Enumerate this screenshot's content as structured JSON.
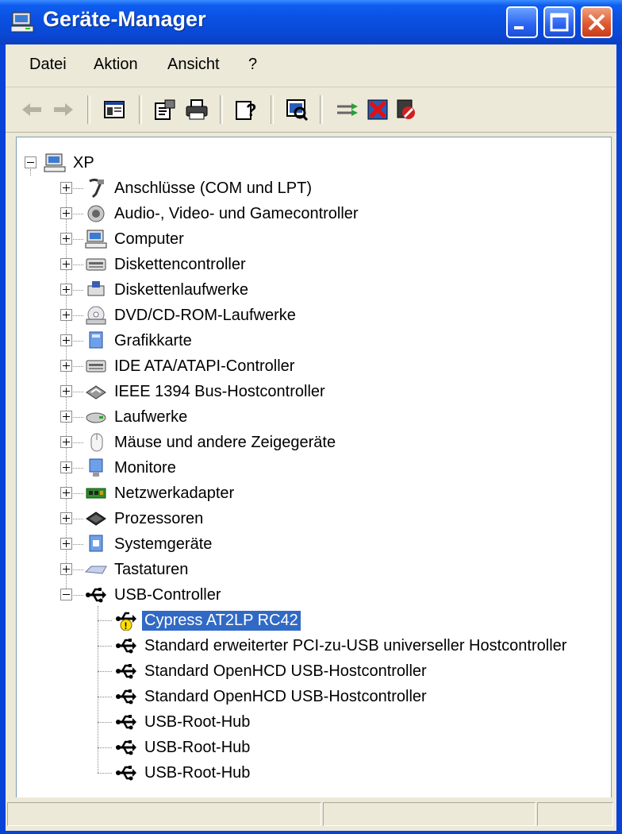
{
  "window": {
    "title": "Geräte-Manager"
  },
  "menu": [
    {
      "label": "Datei"
    },
    {
      "label": "Aktion"
    },
    {
      "label": "Ansicht"
    },
    {
      "label": "?"
    }
  ],
  "tree": {
    "root": {
      "label": "XP",
      "icon": "computer-icon"
    },
    "categories": [
      {
        "label": "Anschlüsse (COM und LPT)",
        "icon": "port-icon"
      },
      {
        "label": "Audio-, Video- und Gamecontroller",
        "icon": "speaker-icon"
      },
      {
        "label": "Computer",
        "icon": "computer-icon"
      },
      {
        "label": "Diskettencontroller",
        "icon": "controller-icon"
      },
      {
        "label": "Diskettenlaufwerke",
        "icon": "floppy-icon"
      },
      {
        "label": "DVD/CD-ROM-Laufwerke",
        "icon": "cdrom-icon"
      },
      {
        "label": "Grafikkarte",
        "icon": "display-adapter-icon"
      },
      {
        "label": "IDE ATA/ATAPI-Controller",
        "icon": "controller-icon"
      },
      {
        "label": "IEEE 1394 Bus-Hostcontroller",
        "icon": "firewire-icon"
      },
      {
        "label": "Laufwerke",
        "icon": "drive-icon"
      },
      {
        "label": "Mäuse und andere Zeigegeräte",
        "icon": "mouse-icon"
      },
      {
        "label": "Monitore",
        "icon": "monitor-icon"
      },
      {
        "label": "Netzwerkadapter",
        "icon": "network-card-icon"
      },
      {
        "label": "Prozessoren",
        "icon": "cpu-icon"
      },
      {
        "label": "Systemgeräte",
        "icon": "system-icon"
      },
      {
        "label": "Tastaturen",
        "icon": "keyboard-icon"
      },
      {
        "label": "USB-Controller",
        "icon": "usb-icon"
      }
    ],
    "usb_children": [
      {
        "label": "Cypress AT2LP RC42",
        "icon": "usb-warning-icon",
        "selected": true
      },
      {
        "label": "Standard erweiterter PCI-zu-USB universeller Hostcontroller",
        "icon": "usb-icon"
      },
      {
        "label": "Standard OpenHCD USB-Hostcontroller",
        "icon": "usb-icon"
      },
      {
        "label": "Standard OpenHCD USB-Hostcontroller",
        "icon": "usb-icon"
      },
      {
        "label": "USB-Root-Hub",
        "icon": "usb-icon"
      },
      {
        "label": "USB-Root-Hub",
        "icon": "usb-icon"
      },
      {
        "label": "USB-Root-Hub",
        "icon": "usb-icon"
      }
    ]
  },
  "colors": {
    "titlebar": "#0a4fe0",
    "selection": "#316ac5",
    "chrome": "#ece9d8"
  }
}
